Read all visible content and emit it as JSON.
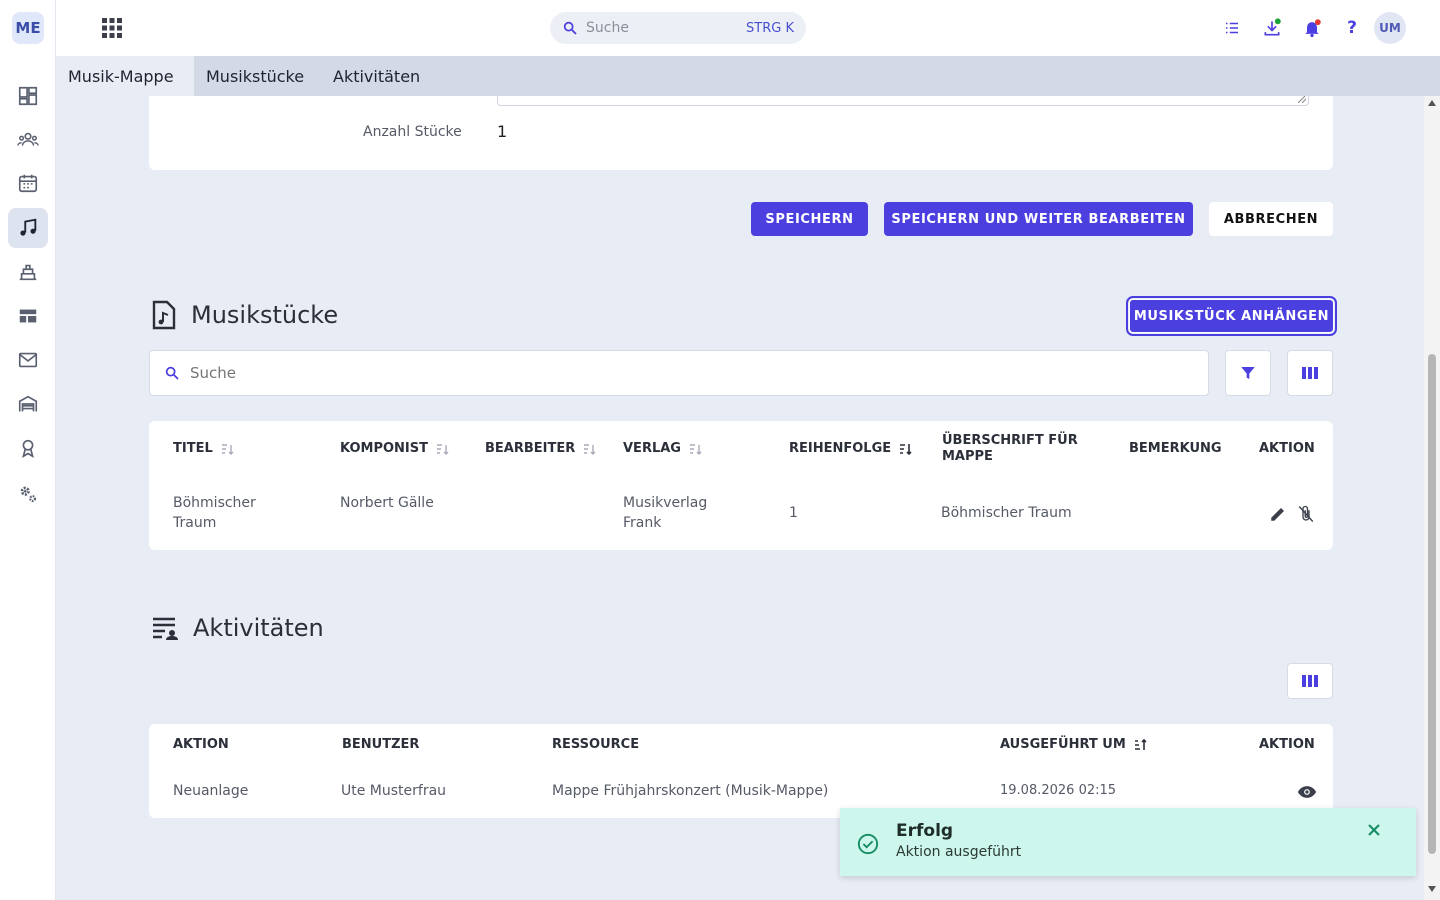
{
  "app": {
    "logo": "ME"
  },
  "sidebar": {
    "items": [
      {
        "name": "dashboard-icon"
      },
      {
        "name": "people-icon"
      },
      {
        "name": "calendar-icon"
      },
      {
        "name": "music-note-icon",
        "active": true
      },
      {
        "name": "inventory-icon"
      },
      {
        "name": "table-icon"
      },
      {
        "name": "mail-icon"
      },
      {
        "name": "warehouse-icon"
      },
      {
        "name": "award-icon"
      },
      {
        "name": "settings-icon"
      }
    ]
  },
  "topbar": {
    "search_placeholder": "Suche",
    "shortcut": "STRG K",
    "avatar": "UM"
  },
  "tabs": [
    "Musik-Mappe",
    "Musikstücke",
    "Aktivitäten"
  ],
  "form": {
    "count_label": "Anzahl Stücke",
    "count_value": "1",
    "save": "SPEICHERN",
    "save_continue": "SPEICHERN UND WEITER BEARBEITEN",
    "cancel": "ABBRECHEN"
  },
  "pieces": {
    "title": "Musikstücke",
    "attach": "MUSIKSTÜCK ANHÄNGEN",
    "search_placeholder": "Suche",
    "columns": [
      "TITEL",
      "KOMPONIST",
      "BEARBEITER",
      "VERLAG",
      "REIHENFOLGE",
      "ÜBERSCHRIFT FÜR MAPPE",
      "BEMERKUNG",
      "AKTION"
    ],
    "rows": [
      {
        "titel": "Böhmischer Traum",
        "komponist": "Norbert Gälle",
        "bearbeiter": "",
        "verlag": "Musikverlag Frank",
        "reihenfolge": "1",
        "ueberschrift": "Böhmischer Traum",
        "bemerkung": ""
      }
    ]
  },
  "activities": {
    "title": "Aktivitäten",
    "columns": [
      "AKTION",
      "BENUTZER",
      "RESSOURCE",
      "AUSGEFÜHRT UM",
      "AKTION"
    ],
    "rows": [
      {
        "aktion": "Neuanlage",
        "benutzer": "Ute Musterfrau",
        "ressource": "Mappe Frühjahrskonzert (Musik-Mappe)",
        "zeit": "19.08.2026 02:15"
      }
    ]
  },
  "toast": {
    "title": "Erfolg",
    "message": "Aktion ausgeführt"
  },
  "colors": {
    "primary": "#4c3fe0",
    "success": "#1aa37a",
    "toast_bg": "#cdf7ec"
  }
}
